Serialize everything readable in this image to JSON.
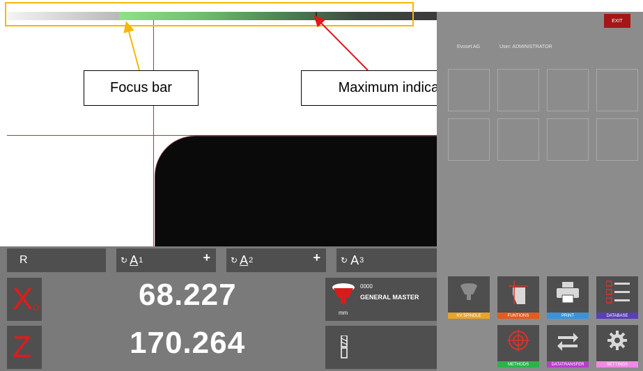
{
  "annotations": {
    "focus_bar_label": "Focus bar",
    "maximum_indicator_label": "Maximum indicator",
    "highlight_color": "#f5b800",
    "arrow_focus_color": "#f5b800",
    "arrow_max_color": "#e01818"
  },
  "header": {
    "exit_label": "EXIT",
    "company": "Evoset AG",
    "user": "User: ADMINISTRATOR"
  },
  "axes": {
    "r_label": "R",
    "a1": {
      "letter": "A",
      "index": "1"
    },
    "a2": {
      "letter": "A",
      "index": "2"
    },
    "a3": {
      "letter": "A",
      "index": "3"
    }
  },
  "readouts": {
    "x": {
      "letter": "X",
      "subscript": "D",
      "value": "68.227"
    },
    "z": {
      "letter": "Z",
      "value": "170.264"
    }
  },
  "tool": {
    "number": "0000",
    "name": "GENERAL MASTER",
    "unit": "mm"
  },
  "functions": [
    {
      "label": "KV SPINDLE",
      "icon": "spindle-icon",
      "color": "#e8a42a"
    },
    {
      "label": "FUNTIONS",
      "icon": "functions-icon",
      "color": "#e35b1f"
    },
    {
      "label": "PRINT",
      "icon": "printer-icon",
      "color": "#3a93d9"
    },
    {
      "label": "DATABASE",
      "icon": "database-list-icon",
      "color": "#5a3fb4"
    },
    {
      "label": "METHODS",
      "icon": "target-icon",
      "color": "#2bb34a"
    },
    {
      "label": "DATATRANSFER",
      "icon": "transfer-arrows-icon",
      "color": "#b53fc7"
    },
    {
      "label": "SETTINGS",
      "icon": "gear-icon",
      "color": "#f08ae2"
    }
  ]
}
